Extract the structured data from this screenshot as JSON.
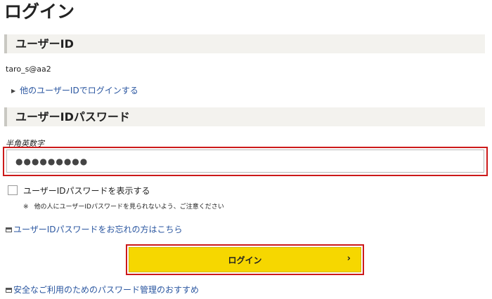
{
  "page": {
    "title": "ログイン"
  },
  "userid_section": {
    "header": "ユーザーID",
    "value": "taro_s@aa2",
    "other_user_link": "他のユーザーIDでログインする"
  },
  "password_section": {
    "header": "ユーザーIDパスワード",
    "hint": "半角英数字",
    "masked_value": "●●●●●●●●●",
    "show_password_label": "ユーザーIDパスワードを表示する",
    "show_password_checked": false,
    "note_mark": "※",
    "note": "他の人にユーザーIDパスワードを見られないよう、ご注意ください",
    "forgot_link": "ユーザーIDパスワードをお忘れの方はこちら"
  },
  "login_button": {
    "label": "ログイン",
    "chevron": "›"
  },
  "footer": {
    "safe_usage_link": "安全なご利用のためのパスワード管理のおすすめ"
  },
  "colors": {
    "accent_yellow": "#f6d700",
    "highlight_red": "#cc1a1a",
    "link_blue": "#2a56a0",
    "section_bg": "#f3f2ee"
  },
  "icons": {
    "link_marker": "triangle-right-icon",
    "external_window": "window-icon"
  }
}
